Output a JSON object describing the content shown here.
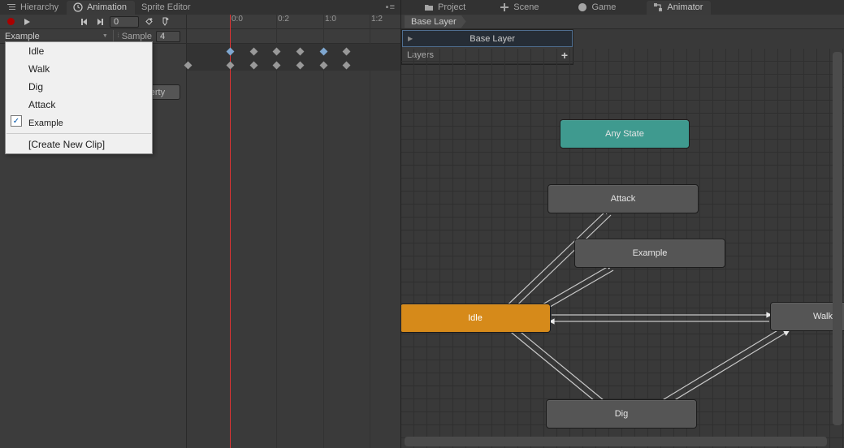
{
  "left": {
    "tabs": {
      "hierarchy": "Hierarchy",
      "animation": "Animation",
      "sprite": "Sprite Editor"
    },
    "tabMenu": "▪≡",
    "frameValue": "0",
    "clipName": "Example",
    "sampleLabel": "Sample",
    "sampleValue": "4",
    "addProperty": "Add Property",
    "ruler": [
      "0:0",
      "0:2",
      "1:0",
      "1:2"
    ],
    "dropdown": {
      "items": [
        "Idle",
        "Walk",
        "Dig",
        "Attack",
        "Example"
      ],
      "createNew": "[Create New Clip]",
      "selected": "Example",
      "check": "✓"
    }
  },
  "right": {
    "tabs": {
      "project": "Project",
      "scene": "Scene",
      "game": "Game",
      "animator": "Animator"
    },
    "breadcrumb": "Base Layer",
    "layers": {
      "selected": "Base Layer",
      "label": "Layers",
      "add": "+"
    },
    "nodes": {
      "anyState": "Any State",
      "attack": "Attack",
      "example": "Example",
      "idle": "Idle",
      "walk": "Walk",
      "dig": "Dig"
    }
  }
}
